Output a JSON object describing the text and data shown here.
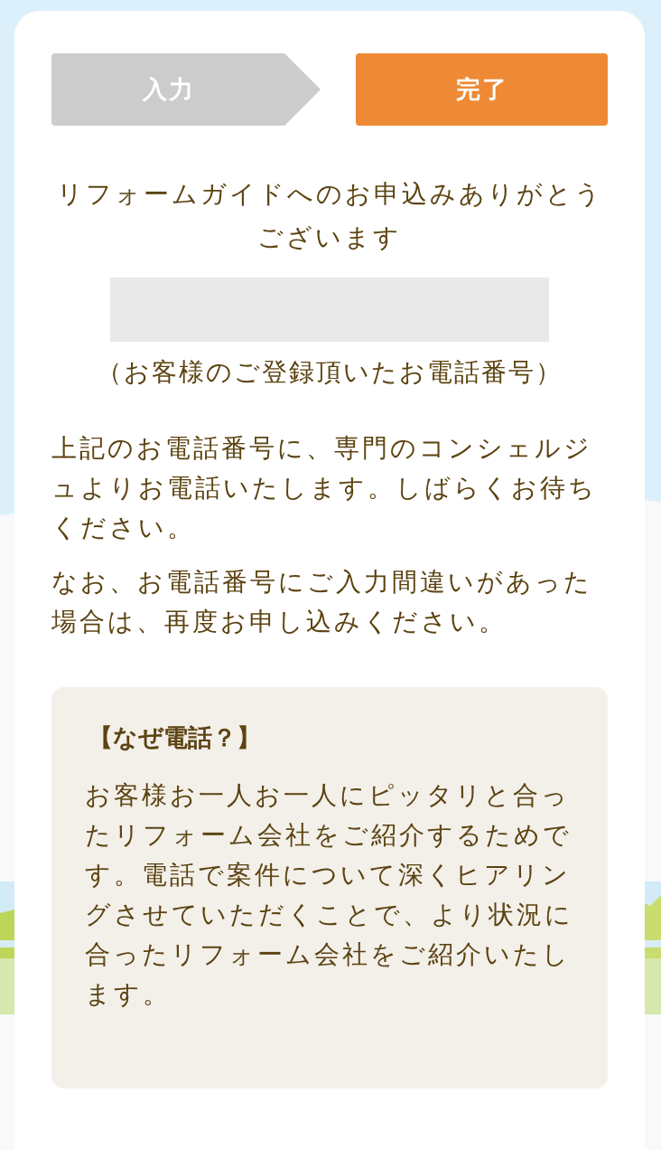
{
  "steps": [
    {
      "label": "入力",
      "selected": false
    },
    {
      "label": "完了",
      "selected": true
    }
  ],
  "thanks": "リフォームガイドへのお申込みありがとうございます",
  "phone_caption": "（お客様のご登録頂いたお電話番号）",
  "paragraphs": [
    "上記のお電話番号に、専門のコンシェルジュよりお電話いたします。しばらくお待ちください。",
    "なお、お電話番号にご入力間違いがあった場合は、再度お申し込みください。"
  ],
  "why_box": {
    "heading": "【なぜ電話？】",
    "body": "お客様お一人お一人にピッタリと合ったリフォーム会社をご紹介するためです。電話で案件について深くヒアリングさせていただくことで、より状況に合ったリフォーム会社をご紹介いたします。"
  }
}
